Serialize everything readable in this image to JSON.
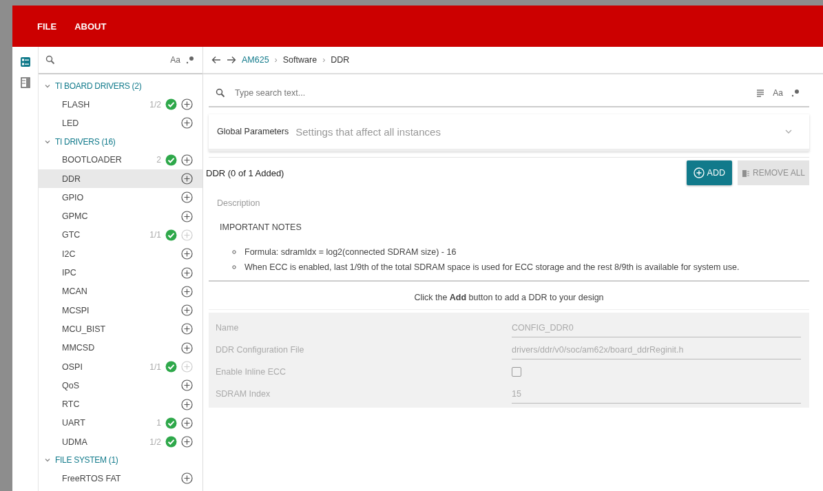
{
  "menu": [
    {
      "label": "FILE"
    },
    {
      "label": "ABOUT"
    }
  ],
  "rail": [
    {
      "kind": "modules",
      "selected": true
    },
    {
      "kind": "panel",
      "selected": false
    }
  ],
  "sidebar": {
    "match_case": "Aa",
    "groups": [
      {
        "label": "TI BOARD DRIVERS (2)",
        "expanded": true,
        "children": [
          {
            "label": "FLASH",
            "count": "1/2",
            "configured": true,
            "add_disabled": false,
            "selected": false
          },
          {
            "label": "LED",
            "configured": false,
            "add_disabled": false,
            "selected": false
          }
        ]
      },
      {
        "label": "TI DRIVERS (16)",
        "expanded": true,
        "children": [
          {
            "label": "BOOTLOADER",
            "count": "2",
            "configured": true,
            "add_disabled": false,
            "selected": false
          },
          {
            "label": "DDR",
            "configured": false,
            "add_disabled": false,
            "selected": true
          },
          {
            "label": "GPIO",
            "configured": false,
            "add_disabled": false,
            "selected": false
          },
          {
            "label": "GPMC",
            "configured": false,
            "add_disabled": false,
            "selected": false
          },
          {
            "label": "GTC",
            "count": "1/1",
            "configured": true,
            "add_disabled": true,
            "selected": false
          },
          {
            "label": "I2C",
            "configured": false,
            "add_disabled": false,
            "selected": false
          },
          {
            "label": "IPC",
            "configured": false,
            "add_disabled": false,
            "selected": false
          },
          {
            "label": "MCAN",
            "configured": false,
            "add_disabled": false,
            "selected": false
          },
          {
            "label": "MCSPI",
            "configured": false,
            "add_disabled": false,
            "selected": false
          },
          {
            "label": "MCU_BIST",
            "configured": false,
            "add_disabled": false,
            "selected": false
          },
          {
            "label": "MMCSD",
            "configured": false,
            "add_disabled": false,
            "selected": false
          },
          {
            "label": "OSPI",
            "count": "1/1",
            "configured": true,
            "add_disabled": true,
            "selected": false
          },
          {
            "label": "QoS",
            "configured": false,
            "add_disabled": false,
            "selected": false
          },
          {
            "label": "RTC",
            "configured": false,
            "add_disabled": false,
            "selected": false
          },
          {
            "label": "UART",
            "count": "1",
            "configured": true,
            "add_disabled": false,
            "selected": false
          },
          {
            "label": "UDMA",
            "count": "1/2",
            "configured": true,
            "add_disabled": false,
            "selected": false
          }
        ]
      },
      {
        "label": "FILE SYSTEM (1)",
        "expanded": true,
        "children": [
          {
            "label": "FreeRTOS FAT",
            "configured": false,
            "add_disabled": false,
            "selected": false
          }
        ]
      }
    ]
  },
  "breadcrumb": {
    "items": [
      "AM625",
      "Software",
      "DDR"
    ],
    "separators": [
      "›",
      "›"
    ]
  },
  "search": {
    "placeholder": "Type search text...",
    "match_case": "Aa"
  },
  "global_parameters": {
    "title": "Global Parameters",
    "subtitle": "Settings that affect all instances",
    "expanded": false
  },
  "module": {
    "title": "DDR (0 of 1 Added)",
    "add_button": "ADD",
    "remove_button": {
      "label": "REMOVE ALL",
      "disabled": true
    },
    "description_label": "Description",
    "notes_title": "IMPORTANT NOTES",
    "notes": [
      "Formula: sdramIdx = log2(connected SDRAM size) - 16",
      "When ECC is enabled, last 1/9th of the total SDRAM space is used for ECC storage and the rest 8/9th is available for system use."
    ],
    "hint": "Click the **Add** button to add a DDR to your design"
  },
  "config": [
    {
      "kind": "text",
      "label": "Name",
      "value": "CONFIG_DDR0"
    },
    {
      "kind": "text",
      "label": "DDR Configuration File",
      "value": "drivers/ddr/v0/soc/am62x/board_ddrReginit.h"
    },
    {
      "kind": "checkbox",
      "label": "Enable Inline ECC",
      "checked": false
    },
    {
      "kind": "text",
      "label": "SDRAM Index",
      "value": "15"
    }
  ]
}
